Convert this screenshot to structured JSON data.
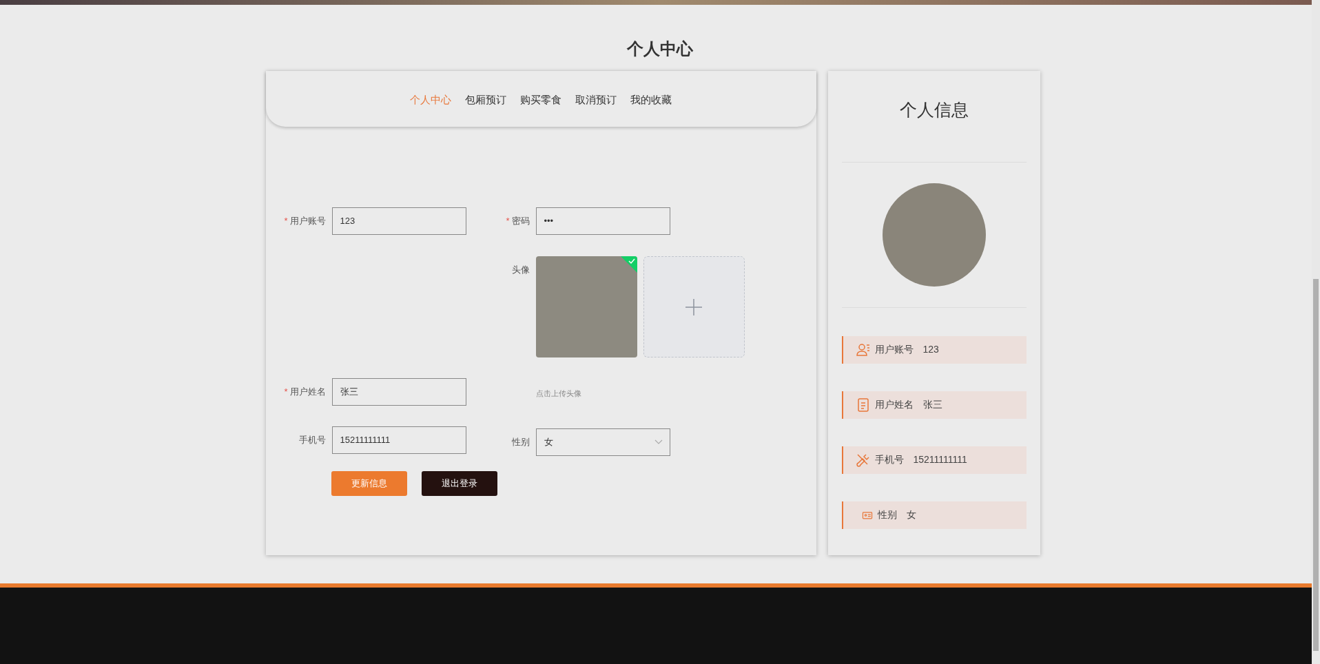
{
  "page_title": "个人中心",
  "tabs": [
    {
      "label": "个人中心",
      "selected": true
    },
    {
      "label": "包厢预订",
      "selected": false
    },
    {
      "label": "购买零食",
      "selected": false
    },
    {
      "label": "取消预订",
      "selected": false
    },
    {
      "label": "我的收藏",
      "selected": false
    }
  ],
  "form": {
    "left_column": [
      {
        "kind": "text",
        "label": "用户账号",
        "required_mark": "*",
        "value": "123"
      },
      {
        "kind": "text",
        "label": "用户姓名",
        "required_mark": "*",
        "value": "张三"
      },
      {
        "kind": "text",
        "label": "手机号",
        "value": "15211111111"
      }
    ],
    "right_column": [
      {
        "kind": "password",
        "label": "密码",
        "required_mark": "*",
        "value": "•••"
      },
      {
        "kind": "avatar",
        "label": "头像",
        "uploaded": true,
        "hint": "点击上传头像"
      },
      {
        "kind": "select",
        "label": "性别",
        "value": "女"
      }
    ],
    "buttons": [
      {
        "kind": "primary",
        "label": "更新信息"
      },
      {
        "kind": "dark",
        "label": "退出登录"
      }
    ]
  },
  "profile": {
    "title": "个人信息",
    "items": [
      {
        "kind": "account",
        "label": "用户账号",
        "value": "123"
      },
      {
        "kind": "name",
        "label": "用户姓名",
        "value": "张三"
      },
      {
        "kind": "phone",
        "label": "手机号",
        "value": "15211111111"
      },
      {
        "kind": "gender",
        "label": "性别",
        "value": "女"
      }
    ]
  }
}
